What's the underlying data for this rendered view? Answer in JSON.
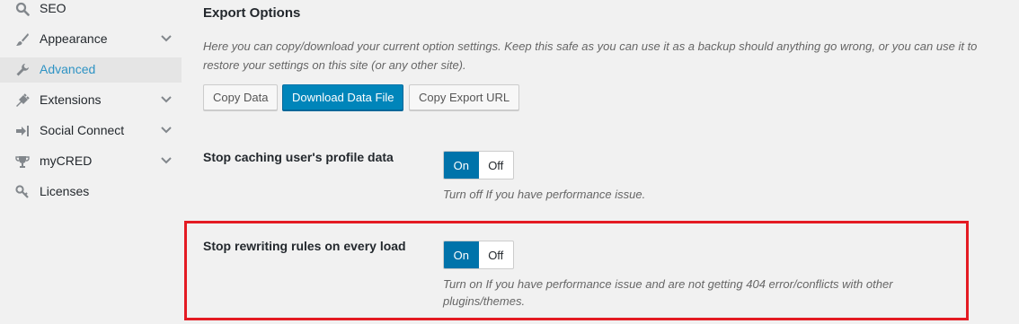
{
  "sidebar": {
    "items": [
      {
        "label": "SEO",
        "icon": "search-icon",
        "has_submenu": false,
        "active": false
      },
      {
        "label": "Appearance",
        "icon": "brush-icon",
        "has_submenu": true,
        "active": false
      },
      {
        "label": "Advanced",
        "icon": "wrench-icon",
        "has_submenu": false,
        "active": true
      },
      {
        "label": "Extensions",
        "icon": "plugin-icon",
        "has_submenu": true,
        "active": false
      },
      {
        "label": "Social Connect",
        "icon": "sign-in-icon",
        "has_submenu": true,
        "active": false
      },
      {
        "label": "myCRED",
        "icon": "trophy-icon",
        "has_submenu": true,
        "active": false
      },
      {
        "label": "Licenses",
        "icon": "key-icon",
        "has_submenu": false,
        "active": false
      }
    ]
  },
  "export": {
    "title": "Export Options",
    "description": "Here you can copy/download your current option settings. Keep this safe as you can use it as a backup should anything go wrong, or you can use it to restore your settings on this site (or any other site).",
    "buttons": {
      "copy_data": "Copy Data",
      "download": "Download Data File",
      "copy_url": "Copy Export URL"
    }
  },
  "options": [
    {
      "label": "Stop caching user's profile data",
      "on_label": "On",
      "off_label": "Off",
      "selected": "On",
      "description": "Turn off If you have performance issue."
    },
    {
      "label": "Stop rewriting rules on every load",
      "on_label": "On",
      "off_label": "Off",
      "selected": "On",
      "description": "Turn on If you have performance issue and are not getting 404 error/conflicts with other plugins/themes."
    }
  ],
  "colors": {
    "accent": "#0073aa",
    "active_link": "#2e93c4",
    "highlight_border": "#e41b23"
  }
}
